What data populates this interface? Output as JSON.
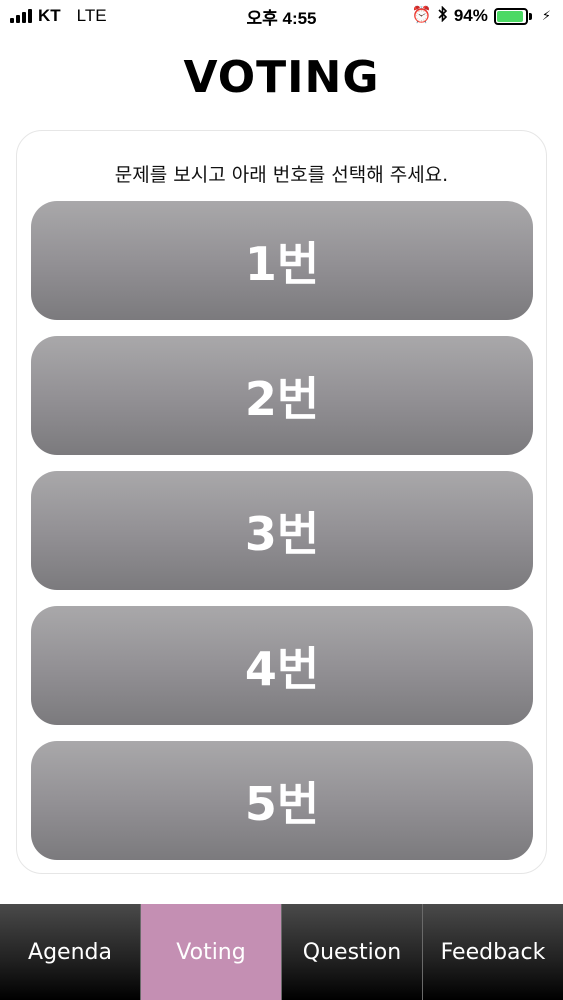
{
  "status_bar": {
    "carrier": "KT",
    "network": "LTE",
    "time": "오후 4:55",
    "battery_text": "94%",
    "battery_level": 0.94,
    "battery_color": "#4cd964",
    "icons": [
      "signal-icon",
      "alarm-icon",
      "bluetooth-icon",
      "battery-icon",
      "charging-icon"
    ]
  },
  "page": {
    "title": "VOTING"
  },
  "card": {
    "instruction": "문제를 보시고 아래 번호를 선택해 주세요.",
    "options": [
      {
        "label": "1번"
      },
      {
        "label": "2번"
      },
      {
        "label": "3번"
      },
      {
        "label": "4번"
      },
      {
        "label": "5번"
      }
    ]
  },
  "tab_bar": {
    "active_color": "#c48fb3",
    "tabs": [
      {
        "label": "Agenda",
        "active": false
      },
      {
        "label": "Voting",
        "active": true
      },
      {
        "label": "Question",
        "active": false
      },
      {
        "label": "Feedback",
        "active": false
      }
    ]
  }
}
